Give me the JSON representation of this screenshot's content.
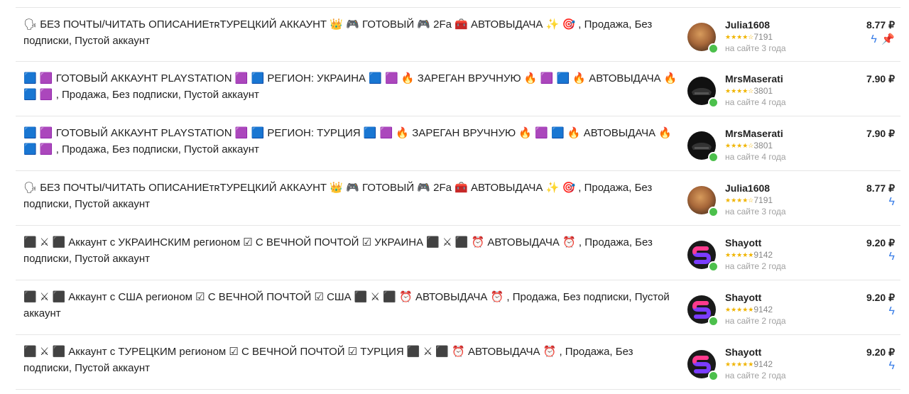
{
  "listings": [
    {
      "description": "🗣 БЕЗ ПОЧТЫ/ЧИТАТЬ ОПИСАНИЕᴛʀТУРЕЦКИЙ АККАУНТ 👑 🎮 ГОТОВЫЙ 🎮 2Fa 🧰 АВТОВЫДАЧА ✨ 🎯 , Продажа, Без подписки, Пустой аккаунт",
      "seller": "Julia1608",
      "stars": "★★★★☆",
      "reviews": "7191",
      "since": "на сайте 3 года",
      "price": "8.77 ₽",
      "avatar": "julia",
      "badges": [
        "bolt-icon",
        "pin-icon"
      ]
    },
    {
      "description": "🟦 🟪 ГОТОВЫЙ АККАУНТ PLAYSTATION 🟪 🟦 РЕГИОН: УКРАИНА 🟦 🟪 🔥 ЗАРЕГАН ВРУЧНУЮ 🔥 🟪 🟦 🔥 АВТОВЫДАЧА 🔥 🟦 🟪 , Продажа, Без подписки, Пустой аккаунт",
      "seller": "MrsMaserati",
      "stars": "★★★★☆",
      "reviews": "3801",
      "since": "на сайте 4 года",
      "price": "7.90 ₽",
      "avatar": "mrs",
      "badges": []
    },
    {
      "description": "🟦 🟪 ГОТОВЫЙ АККАУНТ PLAYSTATION 🟪 🟦 РЕГИОН: ТУРЦИЯ 🟦 🟪 🔥 ЗАРЕГАН ВРУЧНУЮ 🔥 🟪 🟦 🔥 АВТОВЫДАЧА 🔥 🟦 🟪 , Продажа, Без подписки, Пустой аккаунт",
      "seller": "MrsMaserati",
      "stars": "★★★★☆",
      "reviews": "3801",
      "since": "на сайте 4 года",
      "price": "7.90 ₽",
      "avatar": "mrs",
      "badges": []
    },
    {
      "description": "🗣 БЕЗ ПОЧТЫ/ЧИТАТЬ ОПИСАНИЕᴛʀТУРЕЦКИЙ АККАУНТ 👑 🎮 ГОТОВЫЙ 🎮 2Fa 🧰 АВТОВЫДАЧА ✨ 🎯 , Продажа, Без подписки, Пустой аккаунт",
      "seller": "Julia1608",
      "stars": "★★★★☆",
      "reviews": "7191",
      "since": "на сайте 3 года",
      "price": "8.77 ₽",
      "avatar": "julia",
      "badges": [
        "bolt-icon"
      ]
    },
    {
      "description": "⬛ ⚔ ⬛ Аккаунт с УКРАИНСКИМ регионом ☑ С ВЕЧНОЙ ПОЧТОЙ ☑ УКРАИНА ⬛ ⚔ ⬛ ⏰ АВТОВЫДАЧА ⏰ , Продажа, Без подписки, Пустой аккаунт",
      "seller": "Shayott",
      "stars": "★★★★★",
      "reviews": "9142",
      "since": "на сайте 2 года",
      "price": "9.20 ₽",
      "avatar": "shay",
      "badges": [
        "bolt-icon"
      ]
    },
    {
      "description": "⬛ ⚔ ⬛ Аккаунт с США регионом ☑ С ВЕЧНОЙ ПОЧТОЙ ☑ США ⬛ ⚔ ⬛ ⏰ АВТОВЫДАЧА ⏰ , Продажа, Без подписки, Пустой аккаунт",
      "seller": "Shayott",
      "stars": "★★★★★",
      "reviews": "9142",
      "since": "на сайте 2 года",
      "price": "9.20 ₽",
      "avatar": "shay",
      "badges": [
        "bolt-icon"
      ]
    },
    {
      "description": "⬛ ⚔ ⬛ Аккаунт с ТУРЕЦКИМ регионом ☑ С ВЕЧНОЙ ПОЧТОЙ ☑ ТУРЦИЯ ⬛ ⚔ ⬛ ⏰ АВТОВЫДАЧА ⏰ , Продажа, Без подписки, Пустой аккаунт",
      "seller": "Shayott",
      "stars": "★★★★★",
      "reviews": "9142",
      "since": "на сайте 2 года",
      "price": "9.20 ₽",
      "avatar": "shay",
      "badges": [
        "bolt-icon"
      ]
    }
  ]
}
